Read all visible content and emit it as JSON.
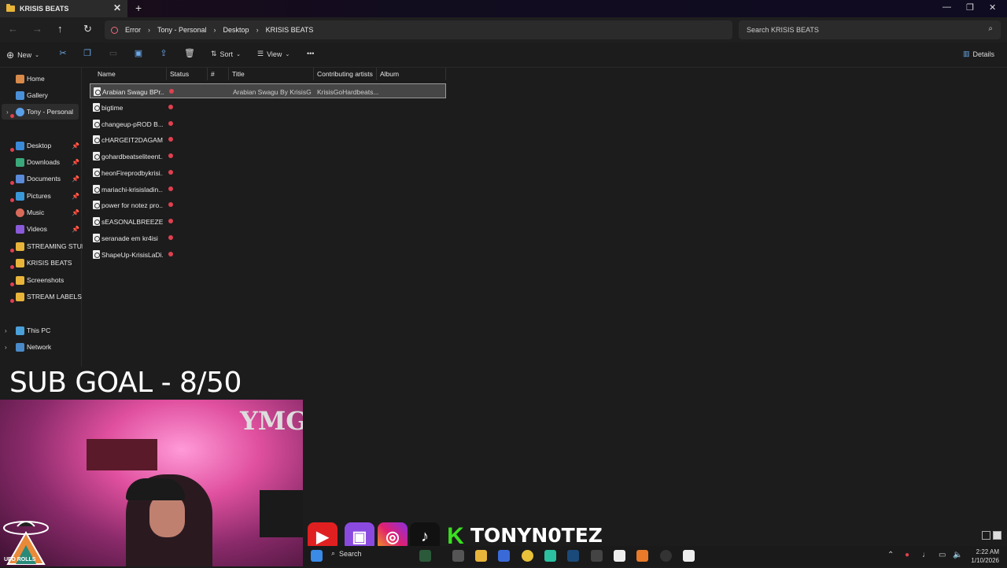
{
  "window": {
    "tab_title": "KRISIS BEATS",
    "tab_close": "✕",
    "new_tab": "+"
  },
  "address": {
    "error_label": "Error",
    "crumbs": [
      "Tony - Personal",
      "Desktop",
      "KRISIS BEATS"
    ],
    "separator": "›"
  },
  "search": {
    "placeholder": "Search KRISIS BEATS"
  },
  "commands": {
    "new": "New",
    "sort": "Sort",
    "view": "View",
    "more": "•••",
    "details": "Details"
  },
  "sidebar": {
    "items": [
      {
        "label": "Home"
      },
      {
        "label": "Gallery"
      },
      {
        "label": "Tony - Personal"
      },
      {
        "label": "Desktop"
      },
      {
        "label": "Downloads"
      },
      {
        "label": "Documents"
      },
      {
        "label": "Pictures"
      },
      {
        "label": "Music"
      },
      {
        "label": "Videos"
      },
      {
        "label": "STREAMING STUFF"
      },
      {
        "label": "KRISIS BEATS"
      },
      {
        "label": "Screenshots"
      },
      {
        "label": "STREAM LABELS"
      },
      {
        "label": "This PC"
      },
      {
        "label": "Network"
      }
    ]
  },
  "columns": [
    "Name",
    "Status",
    "#",
    "Title",
    "Contributing artists",
    "Album"
  ],
  "files": [
    {
      "name": "Arabian Swagu BPr...",
      "title": "Arabian Swagu By KrisisG...",
      "artist": "KrisisGoHardbeats..."
    },
    {
      "name": "bigtime",
      "title": "",
      "artist": ""
    },
    {
      "name": "changeup-pROD B...",
      "title": "",
      "artist": ""
    },
    {
      "name": "cHARGEIT2DAGAM...",
      "title": "",
      "artist": ""
    },
    {
      "name": "gohardbeatseliteent...",
      "title": "",
      "artist": ""
    },
    {
      "name": "heonFireprodbykrisi...",
      "title": "",
      "artist": ""
    },
    {
      "name": "mariachi-krisisladin...",
      "title": "",
      "artist": ""
    },
    {
      "name": "power for notez pro...",
      "title": "",
      "artist": ""
    },
    {
      "name": "sEASONALBREEZE-...",
      "title": "",
      "artist": ""
    },
    {
      "name": "seranade em kr4isi",
      "title": "",
      "artist": ""
    },
    {
      "name": "ShapeUp-KrisisLaDi...",
      "title": "",
      "artist": ""
    }
  ],
  "overlay": {
    "sub_goal": "SUB GOAL -  8/50",
    "webcam_logo": "YMG",
    "ufo_label": "UFO ROLLS",
    "handle": "TONYN0TEZ"
  },
  "taskbar": {
    "search": "Search",
    "time": "2:22 AM",
    "date": "1/10/2026"
  }
}
